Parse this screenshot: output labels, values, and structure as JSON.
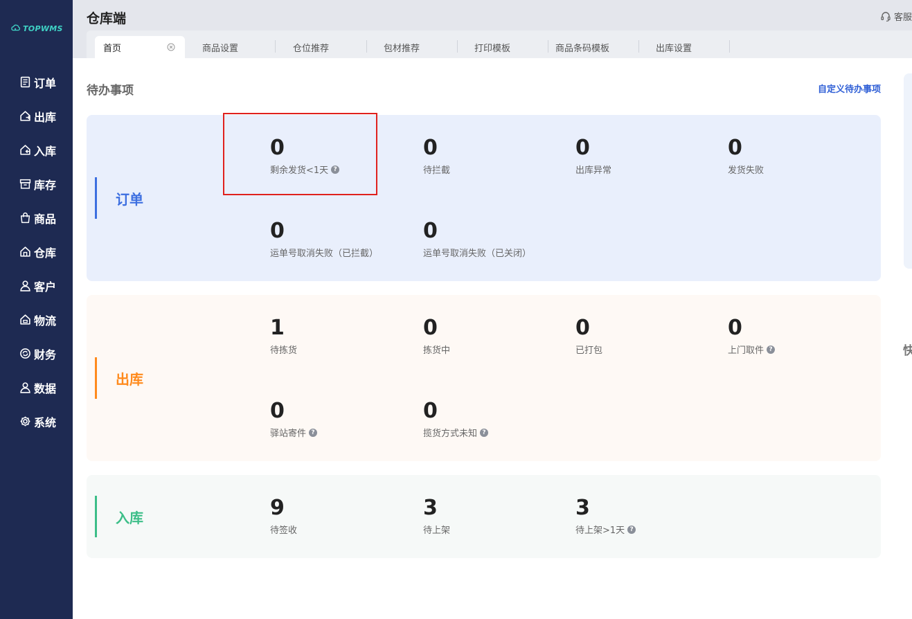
{
  "brand": {
    "logo_text": "TOPWMS",
    "accent": "#3fd1c4"
  },
  "sidebar": {
    "items": [
      {
        "label": "订单",
        "icon": "document-icon"
      },
      {
        "label": "出库",
        "icon": "outbound-icon"
      },
      {
        "label": "入库",
        "icon": "inbound-icon"
      },
      {
        "label": "库存",
        "icon": "archive-icon"
      },
      {
        "label": "商品",
        "icon": "bag-icon"
      },
      {
        "label": "仓库",
        "icon": "warehouse-icon"
      },
      {
        "label": "客户",
        "icon": "user-icon"
      },
      {
        "label": "物流",
        "icon": "logistics-icon"
      },
      {
        "label": "财务",
        "icon": "finance-icon"
      },
      {
        "label": "数据",
        "icon": "data-icon"
      },
      {
        "label": "系统",
        "icon": "gear-icon"
      }
    ]
  },
  "header": {
    "title": "仓库端",
    "service_label": "客服",
    "tabs": [
      {
        "label": "首页",
        "active": true
      },
      {
        "label": "商品设置"
      },
      {
        "label": "仓位推荐"
      },
      {
        "label": "包材推荐"
      },
      {
        "label": "打印模板"
      },
      {
        "label": "商品条码模板"
      },
      {
        "label": "出库设置"
      }
    ]
  },
  "main": {
    "section_title": "待办事项",
    "custom_link": "自定义待办事项",
    "orders": {
      "title": "订单",
      "color": "#3d6fe0",
      "metrics": [
        {
          "value": "0",
          "label": "剩余发货<1天",
          "help": true
        },
        {
          "value": "0",
          "label": "待拦截"
        },
        {
          "value": "0",
          "label": "出库异常"
        },
        {
          "value": "0",
          "label": "发货失败"
        },
        {
          "value": "0",
          "label": "运单号取消失败（已拦截）"
        },
        {
          "value": "0",
          "label": "运单号取消失败（已关闭）"
        }
      ]
    },
    "outbound": {
      "title": "出库",
      "color": "#ff8a1c",
      "metrics": [
        {
          "value": "1",
          "label": "待拣货"
        },
        {
          "value": "0",
          "label": "拣货中"
        },
        {
          "value": "0",
          "label": "已打包"
        },
        {
          "value": "0",
          "label": "上门取件",
          "help": true
        },
        {
          "value": "0",
          "label": "驿站寄件",
          "help": true
        },
        {
          "value": "0",
          "label": "揽货方式未知",
          "help": true
        }
      ]
    },
    "inbound": {
      "title": "入库",
      "color": "#3cbe88",
      "metrics": [
        {
          "value": "9",
          "label": "待签收"
        },
        {
          "value": "3",
          "label": "待上架"
        },
        {
          "value": "3",
          "label": "待上架>1天",
          "help": true
        }
      ]
    }
  },
  "right_panel": {
    "quick_label": "快"
  },
  "help_glyph": "?"
}
